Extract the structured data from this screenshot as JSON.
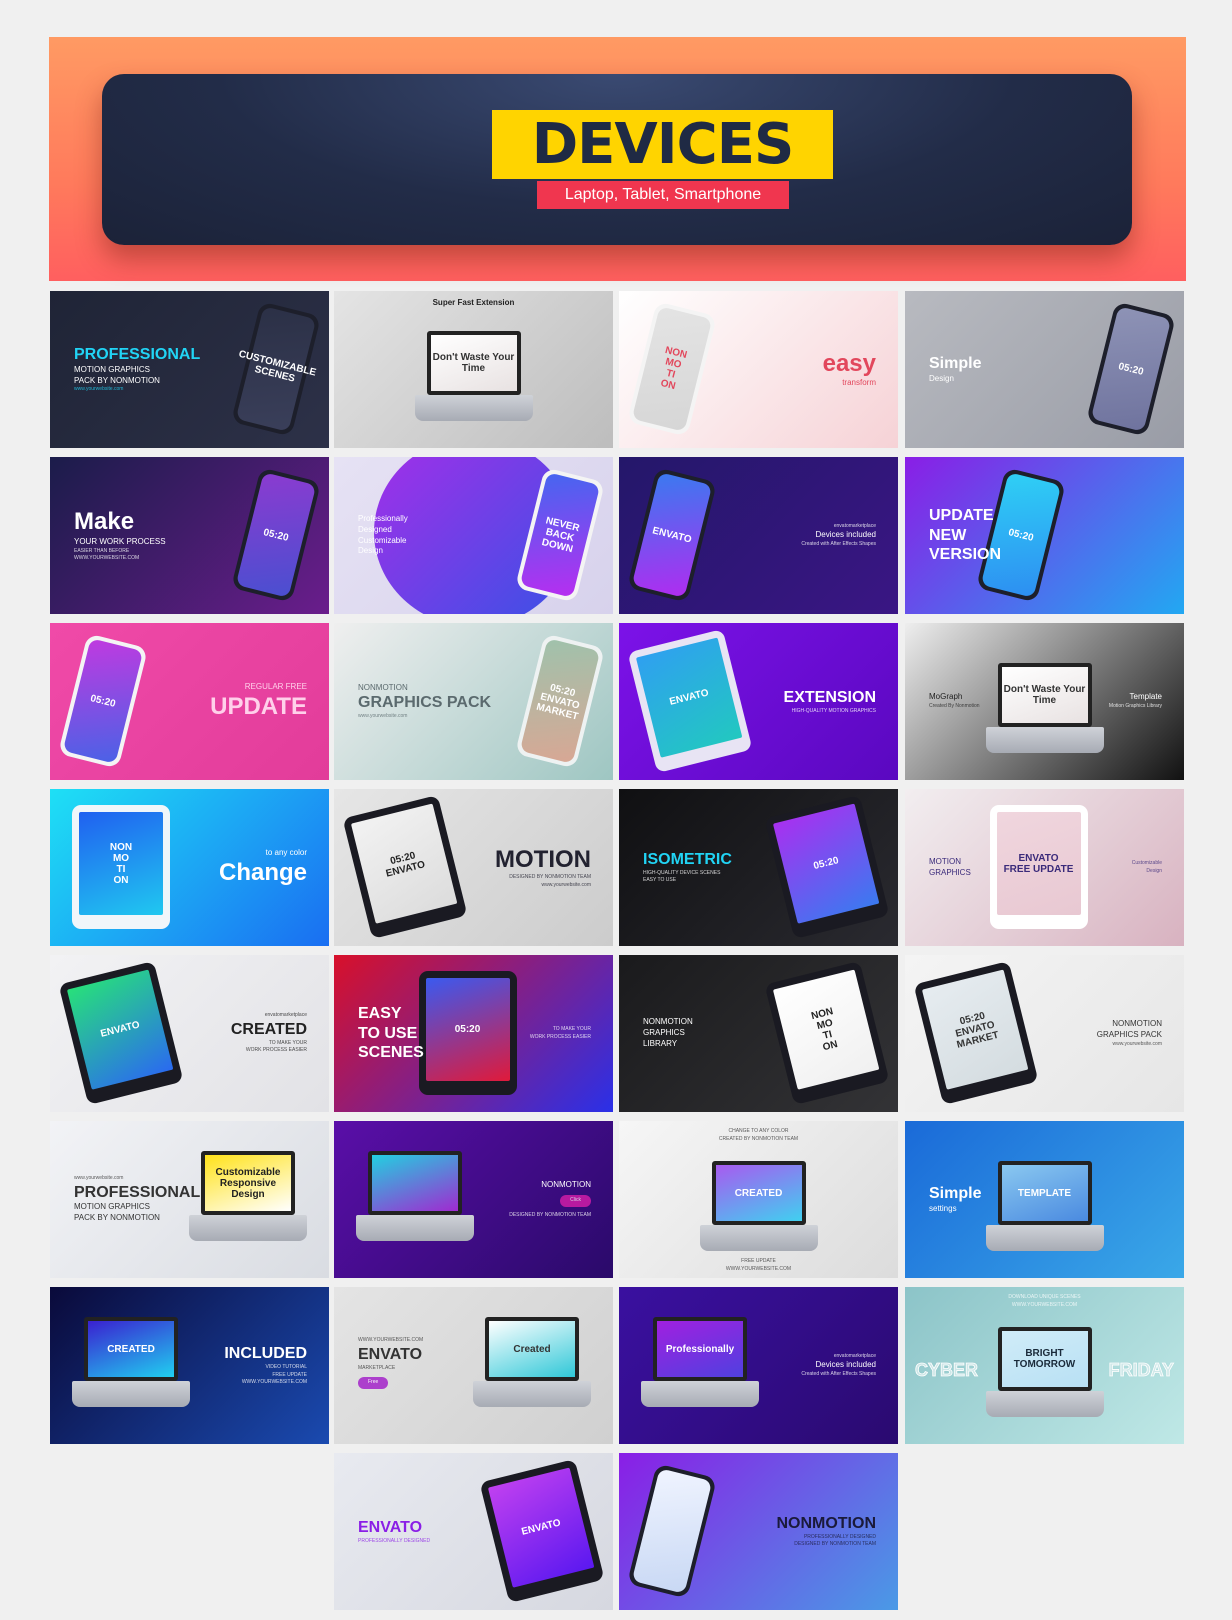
{
  "header": {
    "title": "DEVICES",
    "subtitle": "Laptop, Tablet, Smartphone",
    "colors": {
      "title_bg": "#ffd400",
      "subtitle_bg": "#f0364f",
      "panel": "#222c48"
    }
  },
  "cells": [
    {
      "bg": [
        "#1f2436",
        "#2d3148"
      ],
      "side": "left",
      "color": "#ffffff",
      "accent": "#21d4f5",
      "lines": [
        {
          "t": "PROFESSIONAL",
          "r": "title",
          "a": 1
        },
        {
          "t": "MOTION GRAPHICS",
          "r": "sub"
        },
        {
          "t": "PACK BY NONMOTION",
          "r": "sub"
        },
        {
          "t": "www.yourwebsite.com",
          "r": "small",
          "a": 1
        }
      ],
      "device": {
        "type": "phone",
        "pos": "right",
        "screen": "CUSTOMIZABLE\nSCENES",
        "screen_bg": [
          "#2b3046",
          "#3a3f5a"
        ]
      }
    },
    {
      "bg": [
        "#e4e4e4",
        "#bdbdbd"
      ],
      "side": "top",
      "color": "#222222",
      "lines": [
        {
          "t": "Super Fast Extension",
          "r": "sub"
        }
      ],
      "device": {
        "type": "laptop",
        "pos": "center",
        "screen": "Don't Waste Your Time",
        "screen_bg": [
          "#ffffff",
          "#e8e2e2"
        ],
        "screen_color": "#333333"
      }
    },
    {
      "bg": [
        "#ffffff",
        "#f6d2d6"
      ],
      "side": "right",
      "color": "#e2475c",
      "lines": [
        {
          "t": "easy",
          "r": "big"
        },
        {
          "t": "transform",
          "r": "sub"
        }
      ],
      "device": {
        "type": "phone",
        "pos": "left",
        "screen": "NON\nMO\nTI\nON",
        "screen_bg": [
          "#e4e4e4",
          "#d6d6d6"
        ],
        "screen_color": "#e2475c",
        "frame": "#f4f4f4"
      }
    },
    {
      "bg": [
        "#b8bac0",
        "#999ca6"
      ],
      "side": "left",
      "color": "#ffffff",
      "lines": [
        {
          "t": "Simple",
          "r": "title"
        },
        {
          "t": "Design",
          "r": "sub"
        }
      ],
      "device": {
        "type": "phone",
        "pos": "right",
        "screen": "05:20",
        "screen_bg": [
          "#8e93b6",
          "#6f739e"
        ]
      }
    },
    {
      "bg": [
        "#1b1c4a",
        "#6a1d8c"
      ],
      "side": "left",
      "color": "#ffffff",
      "lines": [
        {
          "t": "Make",
          "r": "big"
        },
        {
          "t": "YOUR WORK PROCESS",
          "r": "sub"
        },
        {
          "t": "EASIER THAN BEFORE",
          "r": "small"
        },
        {
          "t": "WWW.YOURWEBSITE.COM",
          "r": "small"
        }
      ],
      "device": {
        "type": "phone",
        "pos": "right",
        "screen": "05:20",
        "screen_bg": [
          "#8b3bd0",
          "#4a4fd0"
        ]
      }
    },
    {
      "bg": [
        "#e6e2f4",
        "#d7d2ec"
      ],
      "side": "left",
      "color": "#ffffff",
      "blob": [
        "#a52ee8",
        "#3752e6"
      ],
      "lines": [
        {
          "t": "Professionally",
          "r": "sub"
        },
        {
          "t": "Designed",
          "r": "sub"
        },
        {
          "t": "Customizable",
          "r": "sub"
        },
        {
          "t": "Design",
          "r": "sub"
        }
      ],
      "device": {
        "type": "phone",
        "pos": "right",
        "screen": "NEVER\nBACK\nDOWN",
        "screen_bg": [
          "#4566f0",
          "#b72ef0"
        ],
        "frame": "#f4f4f4"
      }
    },
    {
      "bg": [
        "#24176a",
        "#3a1684"
      ],
      "side": "right",
      "color": "#ffffff",
      "lines": [
        {
          "t": "envatomarketplace",
          "r": "small"
        },
        {
          "t": "Devices included",
          "r": "sub"
        },
        {
          "t": "Created with After Effects Shapes",
          "r": "small"
        }
      ],
      "device": {
        "type": "phone",
        "pos": "left",
        "screen": "ENVATO",
        "screen_bg": [
          "#3a7af0",
          "#b02cf0"
        ]
      }
    },
    {
      "bg": [
        "#8a1ee6",
        "#22a8f2"
      ],
      "side": "left",
      "color": "#ffffff",
      "lines": [
        {
          "t": "UPDATE",
          "r": "title"
        },
        {
          "t": "NEW",
          "r": "title"
        },
        {
          "t": "VERSION",
          "r": "title"
        }
      ],
      "device": {
        "type": "phone",
        "pos": "center",
        "screen": "05:20",
        "screen_bg": [
          "#2fd0f5",
          "#2d8ef2"
        ]
      }
    },
    {
      "bg": [
        "#f04aa8",
        "#e23c9a"
      ],
      "side": "right",
      "color": "#ffd0ea",
      "lines": [
        {
          "t": "REGULAR FREE",
          "r": "sub"
        },
        {
          "t": "UPDATE",
          "r": "big"
        }
      ],
      "device": {
        "type": "phone",
        "pos": "left",
        "screen": "05:20",
        "screen_bg": [
          "#c03ae0",
          "#4a62e6"
        ],
        "frame": "#f4f4f4"
      }
    },
    {
      "bg": [
        "#efefef",
        "#9ec6c2"
      ],
      "side": "left",
      "color": "#5b6a6e",
      "lines": [
        {
          "t": "NONMOTION",
          "r": "sub"
        },
        {
          "t": "GRAPHICS PACK",
          "r": "title"
        },
        {
          "t": "www.yourwebsite.com",
          "r": "small"
        }
      ],
      "device": {
        "type": "phone",
        "pos": "right",
        "screen": "05:20\nENVATO\nMARKET",
        "screen_bg": [
          "#9fc2ac",
          "#d8a794"
        ],
        "frame": "#eef2f2"
      }
    },
    {
      "bg": [
        "#7c12e8",
        "#5a08c0"
      ],
      "side": "right",
      "color": "#ffffff",
      "lines": [
        {
          "t": "EXTENSION",
          "r": "title"
        },
        {
          "t": "HIGH-QUALITY MOTION GRAPHICS",
          "r": "small"
        }
      ],
      "device": {
        "type": "tablet",
        "pos": "left",
        "screen": "ENVATO",
        "screen_bg": [
          "#2fa0f0",
          "#22c8c0"
        ],
        "frame": "#e8e4f4"
      }
    },
    {
      "bg": [
        "#eeeeee",
        "#111111"
      ],
      "side": "left",
      "color": "#222222",
      "lines": [
        {
          "t": "MoGraph",
          "r": "sub"
        },
        {
          "t": "Created By Nonmotion",
          "r": "small"
        },
        {
          "t": "Template",
          "r": "sub",
          "a": 2
        },
        {
          "t": "Motion Graphics Library",
          "r": "small",
          "a": 2
        }
      ],
      "device": {
        "type": "laptop",
        "pos": "center",
        "screen": "Don't Waste Your Time",
        "screen_bg": [
          "#ffffff",
          "#e8e2e2"
        ],
        "screen_color": "#333333"
      }
    },
    {
      "bg": [
        "#1ee0f5",
        "#1a6ef2"
      ],
      "side": "right",
      "color": "#ffffff",
      "lines": [
        {
          "t": "to any color",
          "r": "sub"
        },
        {
          "t": "Change",
          "r": "big"
        }
      ],
      "device": {
        "type": "tablet",
        "pos": "left",
        "screen": "NON\nMO\nTI\nON",
        "screen_bg": [
          "#2060f0",
          "#20c8f0"
        ],
        "frame": "#f0f6fa",
        "upright": true
      }
    },
    {
      "bg": [
        "#e6e6e6",
        "#cccccc"
      ],
      "side": "right",
      "color": "#222230",
      "lines": [
        {
          "t": "MOTION",
          "r": "big"
        },
        {
          "t": "DESIGNED BY NONMOTION TEAM",
          "r": "small"
        },
        {
          "t": "www.yourwebsite.com",
          "r": "small"
        }
      ],
      "device": {
        "type": "tablet",
        "pos": "left",
        "screen": "05:20\nENVATO",
        "screen_bg": [
          "#f2f2f2",
          "#dcdcdc"
        ],
        "screen_color": "#222222"
      }
    },
    {
      "bg": [
        "#101012",
        "#2a2a30"
      ],
      "side": "left",
      "color": "#ffffff",
      "accent": "#21d4f5",
      "lines": [
        {
          "t": "ISOMETRIC",
          "r": "title",
          "a": 1
        },
        {
          "t": "HIGH-QUALITY DEVICE SCENES",
          "r": "small"
        },
        {
          "t": "EASY TO USE",
          "r": "small"
        }
      ],
      "device": {
        "type": "tablet",
        "pos": "right",
        "screen": "05:20",
        "screen_bg": [
          "#a830f0",
          "#3a7af0"
        ]
      }
    },
    {
      "bg": [
        "#f2eef0",
        "#d8b2c0"
      ],
      "side": "left",
      "color": "#3a2a7a",
      "lines": [
        {
          "t": "MOTION",
          "r": "sub"
        },
        {
          "t": "GRAPHICS",
          "r": "sub"
        },
        {
          "t": "Customizable",
          "r": "small",
          "a": 2
        },
        {
          "t": "Design",
          "r": "small",
          "a": 2
        }
      ],
      "device": {
        "type": "tablet",
        "pos": "center",
        "screen": "ENVATO\nFREE UPDATE",
        "screen_bg": [
          "#f0d6de",
          "#e8c8d2"
        ],
        "screen_color": "#3a2a7a",
        "frame": "#ffffff",
        "upright": true
      }
    },
    {
      "bg": [
        "#f2f2f4",
        "#e2e2e6"
      ],
      "side": "right",
      "color": "#222222",
      "lines": [
        {
          "t": "envatomarketplace",
          "r": "small"
        },
        {
          "t": "CREATED",
          "r": "title"
        },
        {
          "t": "TO MAKE YOUR",
          "r": "small"
        },
        {
          "t": "WORK PROCESS EASIER",
          "r": "small"
        }
      ],
      "device": {
        "type": "tablet",
        "pos": "left",
        "screen": "ENVATO",
        "screen_bg": [
          "#28e07a",
          "#2a6af0"
        ]
      }
    },
    {
      "bg": [
        "#d8102a",
        "#2a30e8"
      ],
      "side": "left",
      "color": "#ffffff",
      "lines": [
        {
          "t": "EASY",
          "r": "title"
        },
        {
          "t": "TO USE",
          "r": "title"
        },
        {
          "t": "SCENES",
          "r": "title"
        },
        {
          "t": "TO MAKE YOUR",
          "r": "small",
          "a": 2
        },
        {
          "t": "WORK PROCESS EASIER",
          "r": "small",
          "a": 2
        }
      ],
      "device": {
        "type": "tablet",
        "pos": "center",
        "screen": "05:20",
        "screen_bg": [
          "#3a5af0",
          "#e01a3a"
        ],
        "upright": true
      }
    },
    {
      "bg": [
        "#1a1a1c",
        "#333336"
      ],
      "side": "left",
      "color": "#ffffff",
      "lines": [
        {
          "t": "NONMOTION",
          "r": "sub"
        },
        {
          "t": "GRAPHICS",
          "r": "sub"
        },
        {
          "t": "LIBRARY",
          "r": "sub"
        }
      ],
      "device": {
        "type": "tablet",
        "pos": "right",
        "screen": "NON\nMO\nTI\nON",
        "screen_bg": [
          "#ffffff",
          "#f0f0f0"
        ],
        "screen_color": "#222222"
      }
    },
    {
      "bg": [
        "#f4f4f4",
        "#e6e6e6"
      ],
      "side": "right",
      "color": "#333333",
      "lines": [
        {
          "t": "NONMOTION",
          "r": "sub"
        },
        {
          "t": "GRAPHICS PACK",
          "r": "sub"
        },
        {
          "t": "www.yourwebsite.com",
          "r": "small"
        }
      ],
      "device": {
        "type": "tablet",
        "pos": "left",
        "screen": "05:20\nENVATO\nMARKET",
        "screen_bg": [
          "#e6ecf0",
          "#d4dce0"
        ],
        "screen_color": "#333333"
      }
    },
    {
      "bg": [
        "#f2f3f6",
        "#d9dce2"
      ],
      "side": "left",
      "color": "#333333",
      "lines": [
        {
          "t": "www.yourwebsite.com",
          "r": "small"
        },
        {
          "t": "PROFESSIONAL",
          "r": "title"
        },
        {
          "t": "MOTION GRAPHICS",
          "r": "sub"
        },
        {
          "t": "PACK BY NONMOTION",
          "r": "sub"
        }
      ],
      "device": {
        "type": "laptop",
        "pos": "right",
        "screen": "Customizable\nResponsive Design",
        "screen_bg": [
          "#ffe21a",
          "#ffffff"
        ],
        "screen_color": "#222222"
      }
    },
    {
      "bg": [
        "#5a0ea8",
        "#2a0a6a"
      ],
      "side": "right",
      "color": "#ffffff",
      "lines": [
        {
          "t": "NONMOTION",
          "r": "sub"
        },
        {
          "t": "Click",
          "r": "small",
          "btn": "#d81eaa"
        },
        {
          "t": "DESIGNED BY NONMOTION TEAM",
          "r": "small"
        }
      ],
      "device": {
        "type": "laptop",
        "pos": "left",
        "screen": "",
        "screen_bg": [
          "#22d0e0",
          "#a02ad0"
        ]
      }
    },
    {
      "bg": [
        "#f6f6f6",
        "#dcdcdc"
      ],
      "side": "top",
      "color": "#333333",
      "lines": [
        {
          "t": "CHANGE TO ANY COLOR",
          "r": "small"
        },
        {
          "t": "CREATED BY NONMOTION TEAM",
          "r": "small"
        },
        {
          "t": "FREE UPDATE",
          "r": "small",
          "a": 3
        },
        {
          "t": "WWW.YOURWEBSITE.COM",
          "r": "small",
          "a": 3
        }
      ],
      "device": {
        "type": "laptop",
        "pos": "center",
        "screen": "CREATED",
        "screen_bg": [
          "#a85af0",
          "#40d0f0"
        ]
      }
    },
    {
      "bg": [
        "#1a6ad8",
        "#3aa8e8"
      ],
      "side": "left",
      "color": "#ffffff",
      "lines": [
        {
          "t": "Simple",
          "r": "title"
        },
        {
          "t": "settings",
          "r": "sub"
        }
      ],
      "device": {
        "type": "laptop",
        "pos": "center",
        "screen": "TEMPLATE",
        "screen_bg": [
          "#8ac8f0",
          "#4a8ae0"
        ]
      }
    },
    {
      "bg": [
        "#0a0a3a",
        "#1a4ab0"
      ],
      "side": "right",
      "color": "#ffffff",
      "lines": [
        {
          "t": "INCLUDED",
          "r": "title"
        },
        {
          "t": "VIDEO TUTORIAL",
          "r": "small"
        },
        {
          "t": "FREE UPDATE",
          "r": "small"
        },
        {
          "t": "WWW.YOURWEBSITE.COM",
          "r": "small"
        }
      ],
      "device": {
        "type": "laptop",
        "pos": "left",
        "screen": "CREATED",
        "screen_bg": [
          "#3a20d0",
          "#20d0f0"
        ]
      }
    },
    {
      "bg": [
        "#e4e4e4",
        "#d0d0d0"
      ],
      "side": "left",
      "color": "#333333",
      "lines": [
        {
          "t": "WWW.YOURWEBSITE.COM",
          "r": "small"
        },
        {
          "t": "ENVATO",
          "r": "title"
        },
        {
          "t": "MARKETPLACE",
          "r": "small"
        },
        {
          "t": "Free",
          "r": "small",
          "btn": "#a018c8"
        }
      ],
      "device": {
        "type": "laptop",
        "pos": "right",
        "screen": "Created",
        "screen_bg": [
          "#ffffff",
          "#30c8d8"
        ],
        "screen_color": "#333333"
      }
    },
    {
      "bg": [
        "#3a10a0",
        "#2a0a70"
      ],
      "side": "right",
      "color": "#ffffff",
      "lines": [
        {
          "t": "envatomarketplace",
          "r": "small"
        },
        {
          "t": "Devices included",
          "r": "sub"
        },
        {
          "t": "Created with After Effects Shapes",
          "r": "small"
        }
      ],
      "device": {
        "type": "laptop",
        "pos": "left",
        "screen": "Professionally",
        "screen_bg": [
          "#a020e0",
          "#5040e0"
        ]
      }
    },
    {
      "bg": [
        "#8cc4c8",
        "#bfe8e6"
      ],
      "side": "top",
      "color": "#ffffff",
      "lines": [
        {
          "t": "DOWNLOAD UNIQUE SCENES",
          "r": "small"
        },
        {
          "t": "WWW.YOURWEBSITE.COM",
          "r": "small"
        },
        {
          "t": "CYBER",
          "r": "title",
          "a": 4
        },
        {
          "t": "FRIDAY",
          "r": "title",
          "a": 5
        }
      ],
      "device": {
        "type": "laptop",
        "pos": "center",
        "screen": "BRIGHT\nTOMORROW",
        "screen_bg": [
          "#d0ecf8",
          "#b8e0f4"
        ],
        "screen_color": "#1a2a3a"
      }
    },
    {
      "bg": [
        "#e8eaf0",
        "#d6d8e0"
      ],
      "side": "left",
      "color": "#8a1ee6",
      "lines": [
        {
          "t": "ENVATO",
          "r": "title"
        },
        {
          "t": "PROFESSIONALLY DESIGNED",
          "r": "small"
        }
      ],
      "device": {
        "type": "tablet",
        "pos": "right",
        "screen": "ENVATO",
        "screen_bg": [
          "#c040f0",
          "#5a18f0"
        ]
      }
    },
    {
      "bg": [
        "#8a1ee6",
        "#4a9ae6"
      ],
      "side": "right",
      "color": "#1a1a3a",
      "lines": [
        {
          "t": "NONMOTION",
          "r": "title"
        },
        {
          "t": "PROFESSIONALLY DESIGNED",
          "r": "small"
        },
        {
          "t": "DESIGNED BY NONMOTION TEAM",
          "r": "small"
        }
      ],
      "device": {
        "type": "phone",
        "pos": "left",
        "screen": "",
        "screen_bg": [
          "#f0f4ff",
          "#c8d8f4"
        ],
        "frame": "#1d1f2b"
      }
    }
  ]
}
